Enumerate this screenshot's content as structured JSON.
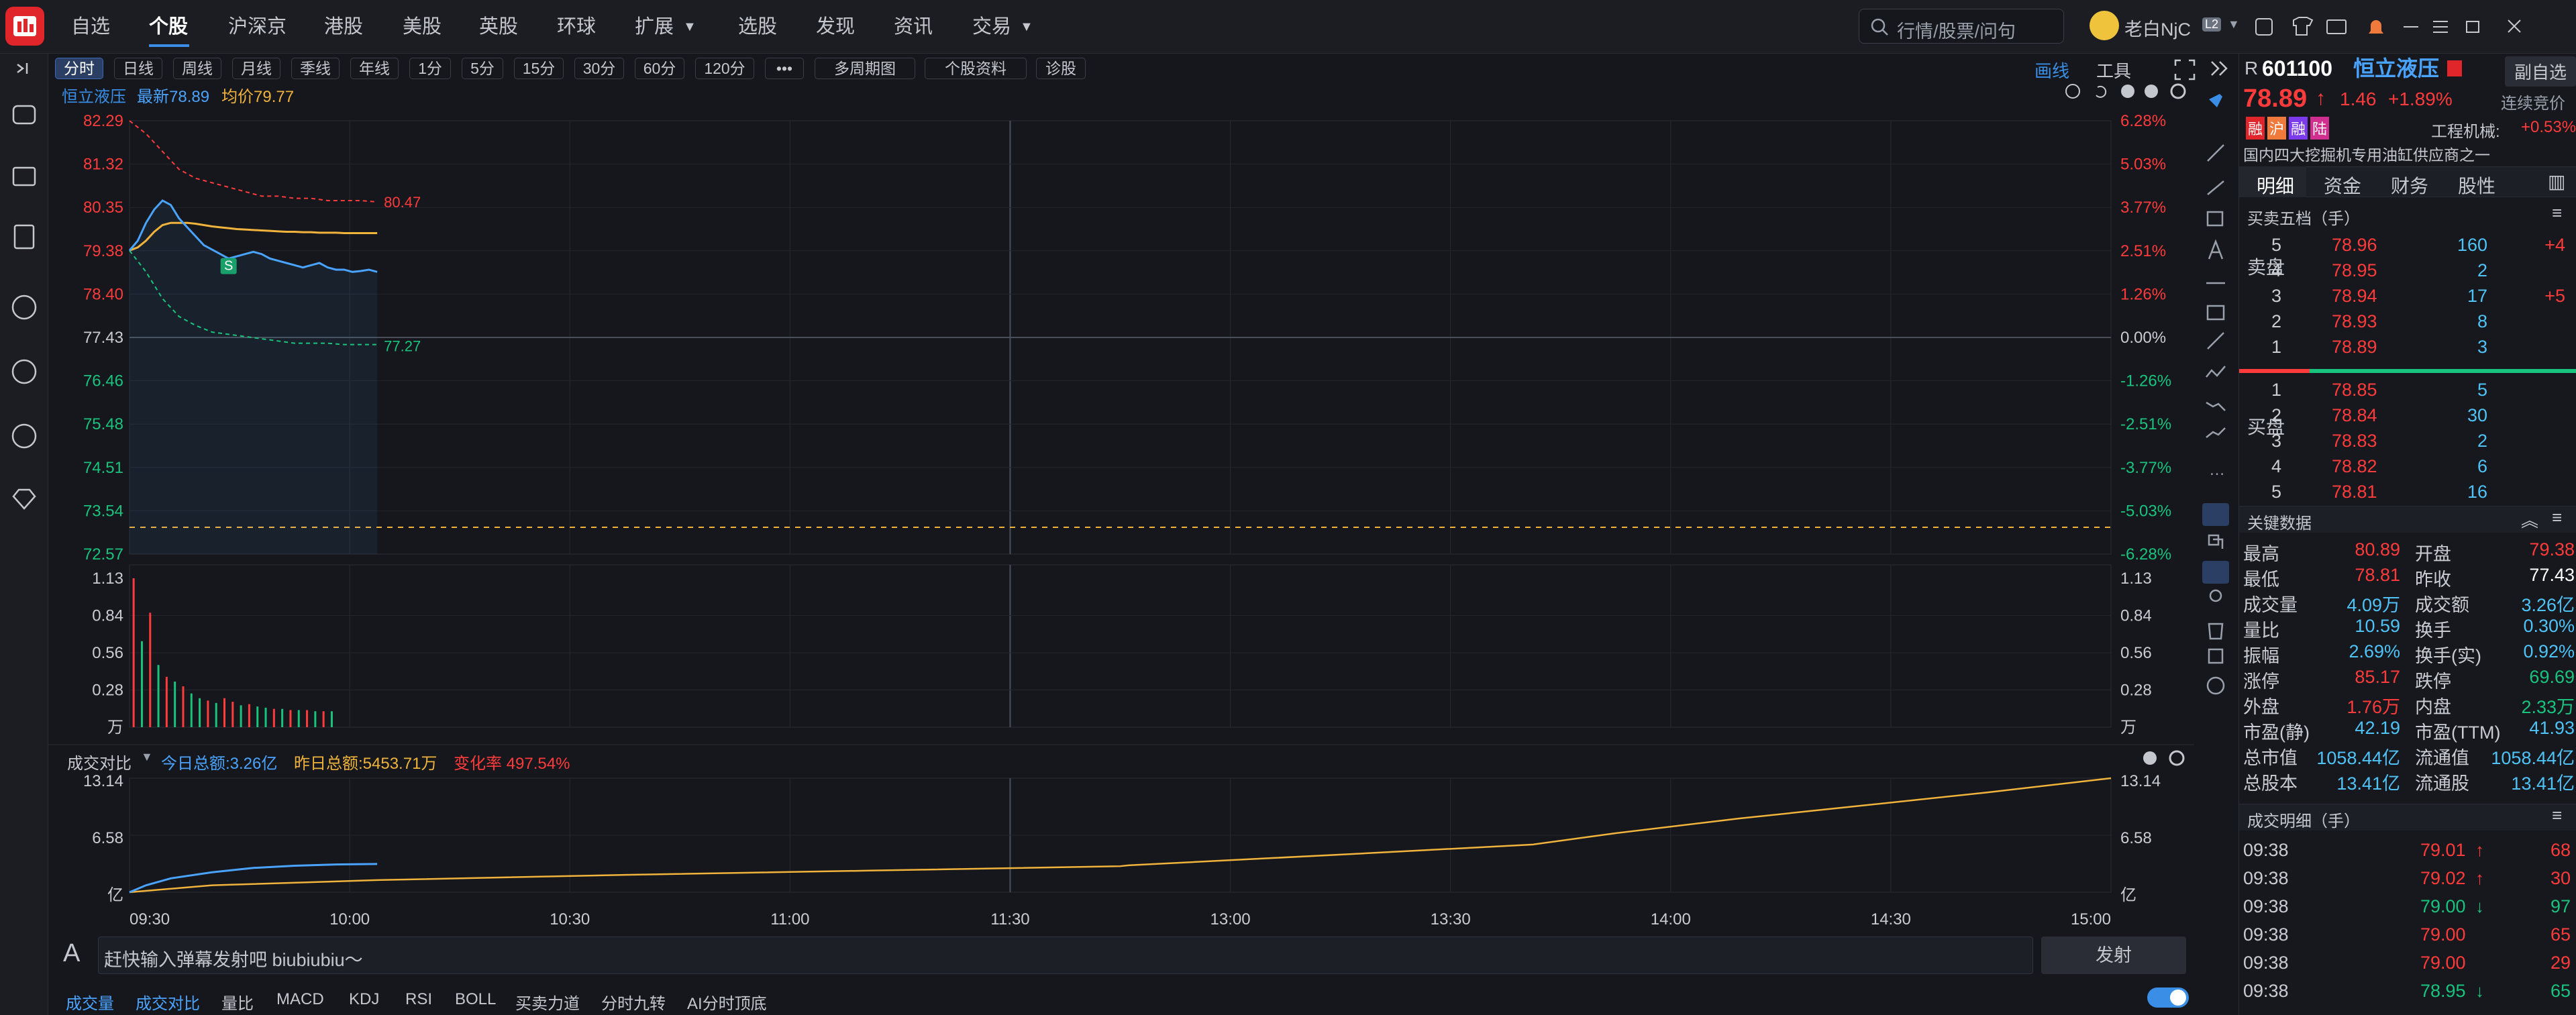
{
  "app": {
    "title": "同花顺"
  },
  "nav": [
    "自选",
    "个股",
    "沪深京",
    "港股",
    "美股",
    "英股",
    "环球",
    "扩展",
    "选股",
    "发现",
    "资讯",
    "交易"
  ],
  "search": {
    "placeholder": "行情/股票/问句"
  },
  "user": {
    "name": "老白NjC",
    "level": "L2"
  },
  "periods": [
    "分时",
    "日线",
    "周线",
    "月线",
    "季线",
    "年线",
    "1分",
    "5分",
    "15分",
    "30分",
    "60分",
    "120分",
    "•••",
    "多周期图",
    "个股资料",
    "诊股"
  ],
  "draw_label": "画线",
  "tools_label": "工具",
  "ticker": {
    "name": "恒立液压",
    "latest": "最新78.89",
    "avg": "均价79.77"
  },
  "price_axis": {
    "left": [
      "82.29",
      "81.32",
      "80.35",
      "79.38",
      "78.40",
      "77.43",
      "76.46",
      "75.48",
      "74.51",
      "73.54",
      "72.57"
    ],
    "right": [
      "6.28%",
      "5.03%",
      "3.77%",
      "2.51%",
      "1.26%",
      "0.00%",
      "-1.26%",
      "-2.51%",
      "-3.77%",
      "-5.03%",
      "-6.28%"
    ]
  },
  "vol_axis": {
    "left": [
      "1.13",
      "0.84",
      "0.56",
      "0.28",
      "万"
    ],
    "right": [
      "1.13",
      "0.84",
      "0.56",
      "0.28",
      "万"
    ]
  },
  "annotations": {
    "hi": "80.47",
    "lo": "77.27",
    "s_marker": "S"
  },
  "compare": {
    "label": "成交对比",
    "today": "今日总额:3.26亿",
    "yesterday": "昨日总额:5453.71万",
    "ratio": "变化率 497.54%",
    "axis_left": [
      "13.14",
      "6.58",
      "亿"
    ],
    "axis_right": [
      "13.14",
      "6.58",
      "亿"
    ]
  },
  "times": [
    "09:30",
    "10:00",
    "10:30",
    "11:00",
    "11:30",
    "13:00",
    "13:30",
    "14:00",
    "14:30",
    "15:00"
  ],
  "danmaku": {
    "placeholder": "赶快输入弹幕发射吧 biubiubiu～",
    "send": "发射"
  },
  "bottom_tabs": [
    "成交量",
    "成交对比",
    "量比",
    "MACD",
    "KDJ",
    "RSI",
    "BOLL",
    "买卖力道",
    "分时九转",
    "AI分时顶底"
  ],
  "stock": {
    "r": "R",
    "code": "601100",
    "name": "恒立液压",
    "price": "78.89",
    "change": "1.46",
    "pct": "+1.89%",
    "status": "连续竞价",
    "tags": [
      "融",
      "沪",
      "融",
      "陆"
    ],
    "sector": "工程机械:",
    "sector_pct": "+0.53%",
    "desc": "国内四大挖掘机专用油缸供应商之一",
    "compare_btn": "副自选"
  },
  "rtabs": [
    "明细",
    "资金",
    "财务",
    "股性"
  ],
  "order_title": "买卖五档（手）",
  "sell": [
    {
      "n": "5",
      "p": "78.96",
      "v": "160",
      "d": "+4"
    },
    {
      "n": "4",
      "p": "78.95",
      "v": "2",
      "d": ""
    },
    {
      "n": "3",
      "p": "78.94",
      "v": "17",
      "d": "+5"
    },
    {
      "n": "2",
      "p": "78.93",
      "v": "8",
      "d": ""
    },
    {
      "n": "1",
      "p": "78.89",
      "v": "3",
      "d": ""
    }
  ],
  "buy": [
    {
      "n": "1",
      "p": "78.85",
      "v": "5"
    },
    {
      "n": "2",
      "p": "78.84",
      "v": "30"
    },
    {
      "n": "3",
      "p": "78.83",
      "v": "2"
    },
    {
      "n": "4",
      "p": "78.82",
      "v": "6"
    },
    {
      "n": "5",
      "p": "78.81",
      "v": "16"
    }
  ],
  "sell_label": "卖盘",
  "buy_label": "买盘",
  "key_title": "关键数据",
  "key": [
    [
      "最高",
      "80.89",
      "开盘",
      "79.38"
    ],
    [
      "最低",
      "78.81",
      "昨收",
      "77.43"
    ],
    [
      "成交量",
      "4.09万",
      "成交额",
      "3.26亿"
    ],
    [
      "量比",
      "10.59",
      "换手",
      "0.30%"
    ],
    [
      "振幅",
      "2.69%",
      "换手(实)",
      "0.92%"
    ],
    [
      "涨停",
      "85.17",
      "跌停",
      "69.69"
    ],
    [
      "外盘",
      "1.76万",
      "内盘",
      "2.33万"
    ],
    [
      "市盈(静)",
      "42.19",
      "市盈(TTM)",
      "41.93"
    ],
    [
      "总市值",
      "1058.44亿",
      "流通值",
      "1058.44亿"
    ],
    [
      "总股本",
      "13.41亿",
      "流通股",
      "13.41亿"
    ]
  ],
  "trades_title": "成交明细（手）",
  "trades": [
    {
      "t": "09:38",
      "p": "79.01",
      "a": "up",
      "v": "68"
    },
    {
      "t": "09:38",
      "p": "79.02",
      "a": "up",
      "v": "30"
    },
    {
      "t": "09:38",
      "p": "79.00",
      "a": "down",
      "v": "97"
    },
    {
      "t": "09:38",
      "p": "79.00",
      "a": "",
      "v": "65"
    },
    {
      "t": "09:38",
      "p": "79.00",
      "a": "",
      "v": "29"
    },
    {
      "t": "09:38",
      "p": "78.95",
      "a": "down",
      "v": "65"
    }
  ],
  "colors": {
    "up": "#ff3b3b",
    "down": "#19c37d",
    "price_line": "#4aa3ff",
    "avg_line": "#f0b33c",
    "accent": "#3a8ee6"
  }
}
